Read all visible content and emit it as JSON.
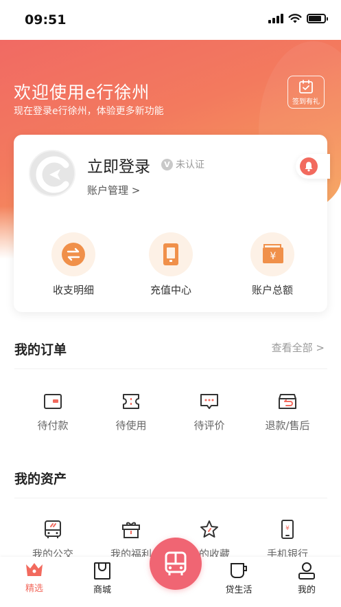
{
  "status": {
    "time": "09:51"
  },
  "header": {
    "title": "欢迎使用e行徐州",
    "subtitle": "现在登录e行徐州，体验更多新功能",
    "signin_label": "签到有礼"
  },
  "account": {
    "login_text": "立即登录",
    "verify_badge": "V",
    "verify_text": "未认证",
    "manage_text": "账户管理 >",
    "quick": [
      {
        "label": "收支明细",
        "icon": "exchange-icon"
      },
      {
        "label": "充值中心",
        "icon": "card-icon"
      },
      {
        "label": "账户总额",
        "icon": "wallet-icon"
      }
    ]
  },
  "orders": {
    "title": "我的订单",
    "view_all": "查看全部 >",
    "items": [
      {
        "label": "待付款",
        "icon": "wallet-icon"
      },
      {
        "label": "待使用",
        "icon": "ticket-icon"
      },
      {
        "label": "待评价",
        "icon": "comment-icon"
      },
      {
        "label": "退款/售后",
        "icon": "refund-box-icon"
      }
    ]
  },
  "assets": {
    "title": "我的资产",
    "items": [
      {
        "label": "我的公交",
        "icon": "bus-icon"
      },
      {
        "label": "我的福利",
        "icon": "gift-icon"
      },
      {
        "label": "我的收藏",
        "icon": "star-icon"
      },
      {
        "label": "手机银行",
        "icon": "phone-icon"
      }
    ]
  },
  "tabbar": {
    "items": [
      {
        "label": "精选",
        "icon": "crown-icon",
        "active": true
      },
      {
        "label": "商城",
        "icon": "shopping-bag-icon"
      },
      {
        "label": "",
        "icon": "bus-icon"
      },
      {
        "label": "贷生活",
        "icon": "cup-icon"
      },
      {
        "label": "我的",
        "icon": "user-icon"
      }
    ]
  },
  "colors": {
    "accent": "#f26a5e",
    "gradient_start": "#f06565",
    "gradient_end": "#f9b266",
    "icon_orange": "#f0904a"
  }
}
